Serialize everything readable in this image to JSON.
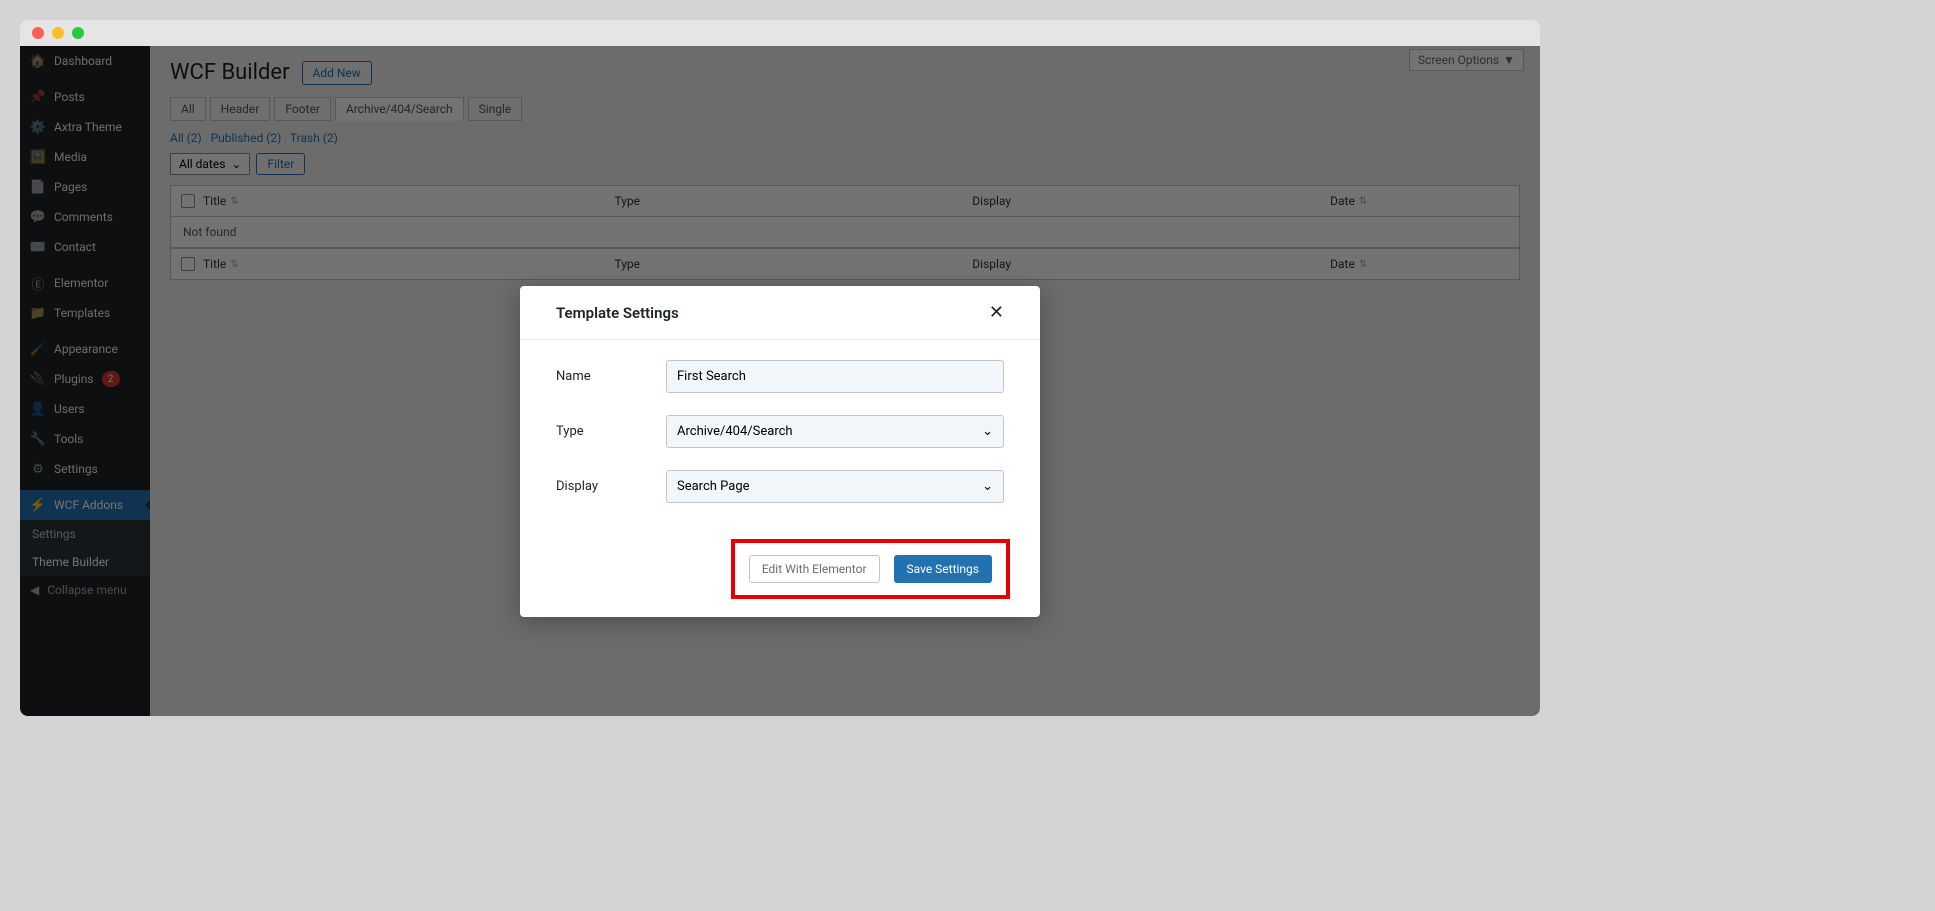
{
  "sidebar": {
    "items": [
      {
        "label": "Dashboard",
        "icon": "🏠"
      },
      {
        "label": "Posts",
        "icon": "📌"
      },
      {
        "label": "Axtra Theme",
        "icon": "⚙️"
      },
      {
        "label": "Media",
        "icon": "🖼️"
      },
      {
        "label": "Pages",
        "icon": "📄"
      },
      {
        "label": "Comments",
        "icon": "💬"
      },
      {
        "label": "Contact",
        "icon": "✉️"
      },
      {
        "label": "Elementor",
        "icon": "Ⓔ"
      },
      {
        "label": "Templates",
        "icon": "📁"
      },
      {
        "label": "Appearance",
        "icon": "🖌️"
      },
      {
        "label": "Plugins",
        "icon": "🔌",
        "badge": "2"
      },
      {
        "label": "Users",
        "icon": "👤"
      },
      {
        "label": "Tools",
        "icon": "🔧"
      },
      {
        "label": "Settings",
        "icon": "⚙"
      },
      {
        "label": "WCF Addons",
        "icon": "⚡"
      }
    ],
    "subs": {
      "settings": "Settings",
      "builder": "Theme Builder"
    },
    "collapse": "Collapse menu"
  },
  "header": {
    "title": "WCF Builder",
    "add_new": "Add New",
    "screen_options": "Screen Options"
  },
  "tabs": [
    "All",
    "Header",
    "Footer",
    "Archive/404/Search",
    "Single"
  ],
  "status_links": {
    "all": "All (2)",
    "pub": "Published (2)",
    "trash": "Trash (2)"
  },
  "filters": {
    "dates": "All dates",
    "filter": "Filter"
  },
  "table": {
    "cols": {
      "title": "Title",
      "type": "Type",
      "display": "Display",
      "date": "Date"
    },
    "not_found": "Not found"
  },
  "modal": {
    "title": "Template Settings",
    "name_label": "Name",
    "name_value": "First Search",
    "type_label": "Type",
    "type_value": "Archive/404/Search",
    "display_label": "Display",
    "display_value": "Search Page",
    "edit_btn": "Edit With Elementor",
    "save_btn": "Save Settings"
  }
}
